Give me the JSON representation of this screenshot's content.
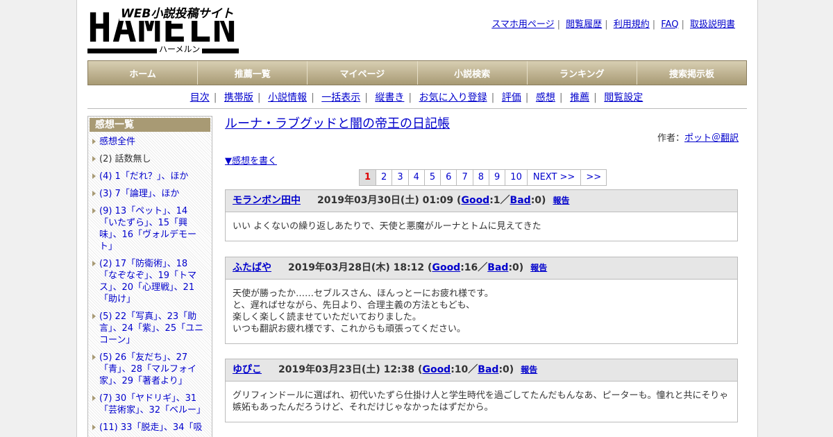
{
  "logo": {
    "main": "HAMELN",
    "sub": "WEB小説投稿サイト",
    "kana": "ハーメルン"
  },
  "top_links": [
    "スマホ用ページ",
    "閲覧履歴",
    "利用規約",
    "FAQ",
    "取扱説明書"
  ],
  "global_nav": [
    "ホーム",
    "推薦一覧",
    "マイページ",
    "小説検索",
    "ランキング",
    "捜索掲示板"
  ],
  "sub_nav": [
    "目次",
    "携帯版",
    "小説情報",
    "一括表示",
    "縦書き",
    "お気に入り登録",
    "評価",
    "感想",
    "推薦",
    "閲覧設定"
  ],
  "sidebar": {
    "heading": "感想一覧",
    "items": [
      "感想全件",
      "(2) 話数無し",
      "(4) 1「だれ？」、ほか",
      "(3) 7「論理」、ほか",
      "(9) 13「ペット」、14「いたずら」、15「興味」、16「ヴォルデモート」",
      "(2) 17「防衛術」、18「なぞなぞ」、19「トマス」、20「心理戦」、21「助け」",
      "(5) 22「写真」、23「助言」、24「紫」、25「ユニコーン」",
      "(5) 26「友だち」、27「青」、28「マルフォイ家」、29「著者より」",
      "(7) 30「ヤドリギ」、31「芸術家」、32「ベルー」",
      "(11) 33「脱走」、34「吸"
    ]
  },
  "main": {
    "title": "ルーナ・ラブグッドと闇の帝王の日記帳",
    "author_label": "作者：",
    "author": "ポット＠翻訳",
    "write_link": "▼感想を書く",
    "pager": [
      "1",
      "2",
      "3",
      "4",
      "5",
      "6",
      "7",
      "8",
      "9",
      "10",
      "NEXT >>",
      ">>"
    ],
    "reviews": [
      {
        "name": "モランボン田中",
        "date": "2019年03月30日(土) 01:09",
        "good_label": "Good",
        "good_count": ":1／",
        "bad_label": "Bad",
        "bad_count": ":0)",
        "report": "報告",
        "body": "いい よくないの繰り返しあたりで、天使と悪魔がルーナとトムに見えてきた"
      },
      {
        "name": "ふたばや",
        "date": "2019年03月28日(木) 18:12",
        "good_label": "Good",
        "good_count": ":16／",
        "bad_label": "Bad",
        "bad_count": ":0)",
        "report": "報告",
        "body": "天使が勝ったか……セブルスさん、ほんっとーにお疲れ様です。\nと、遅ればせながら、先日より、合理主義の方法ともども、\n楽しく楽しく読ませていただいておりました。\nいつも翻訳お疲れ様です、これからも頑張ってください。"
      },
      {
        "name": "ゆぴこ",
        "date": "2019年03月23日(土) 12:38",
        "good_label": "Good",
        "good_count": ":10／",
        "bad_label": "Bad",
        "bad_count": ":0)",
        "report": "報告",
        "body": "グリフィンドールに選ばれ、初代いたずら仕掛け人と学生時代を過ごしてたんだもんなあ、ピーターも。憧れと共にそりゃ嫉妬もあったんだろうけど、それだけじゃなかったはずだから。"
      }
    ]
  }
}
